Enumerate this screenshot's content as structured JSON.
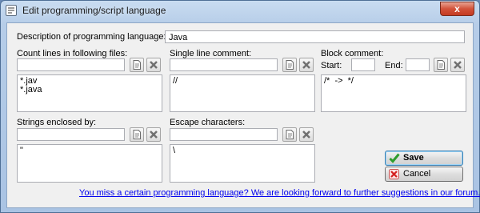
{
  "window": {
    "title": "Edit programming/script language",
    "close_glyph": "x"
  },
  "description": {
    "label": "Description of programming language:",
    "value": "Java"
  },
  "count_lines": {
    "label": "Count lines in following files:",
    "input_value": "",
    "list_text": "*.jav\n*.java"
  },
  "single_line": {
    "label": "Single line comment:",
    "input_value": "",
    "list_text": "//"
  },
  "block_comment": {
    "label": "Block comment:",
    "start_label": "Start:",
    "end_label": "End:",
    "start_value": "",
    "end_value": "",
    "list_text": "/*  ->  */"
  },
  "strings": {
    "label": "Strings enclosed by:",
    "input_value": "",
    "list_text": "\""
  },
  "escape": {
    "label": "Escape characters:",
    "input_value": "",
    "list_text": "\\"
  },
  "buttons": {
    "save": "Save",
    "cancel": "Cancel"
  },
  "footer_link": "You miss a certain programming language? We are looking forward to further suggestions in our forum.",
  "colors": {
    "link": "#0000ee",
    "save_check": "#2e9d2e",
    "cancel_x": "#d42020"
  },
  "icons": [
    "edit-page-icon",
    "delete-x-icon",
    "check-icon",
    "cancel-x-icon",
    "script-icon",
    "close-icon"
  ]
}
